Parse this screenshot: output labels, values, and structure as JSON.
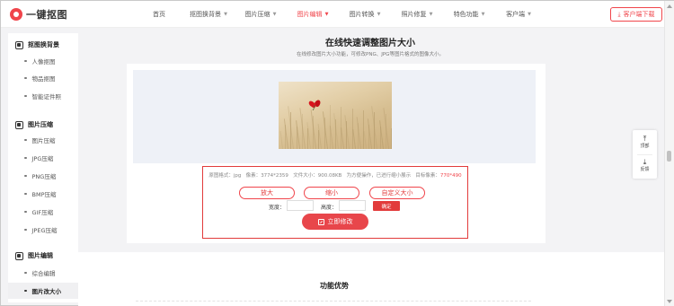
{
  "header": {
    "logo_text": "一键抠图",
    "nav": [
      {
        "label": "首页",
        "caret": false
      },
      {
        "label": "抠图换背景",
        "caret": true
      },
      {
        "label": "图片压缩",
        "caret": true
      },
      {
        "label": "图片编辑",
        "caret": true
      },
      {
        "label": "图片转换",
        "caret": true
      },
      {
        "label": "照片修复",
        "caret": true
      },
      {
        "label": "特色功能",
        "caret": true
      },
      {
        "label": "客户端",
        "caret": true
      }
    ],
    "active_nav": "图片编辑",
    "client_download": "客户端下载"
  },
  "sidebar": {
    "groups": [
      {
        "title": "抠图换背景",
        "icon": "cutout-icon",
        "items": [
          "人像抠图",
          "物品抠图",
          "智能证件照"
        ]
      },
      {
        "title": "图片压缩",
        "icon": "compress-icon",
        "items": [
          "图片压缩",
          "JPG压缩",
          "PNG压缩",
          "BMP压缩",
          "GIF压缩",
          "JPEG压缩"
        ]
      },
      {
        "title": "图片编辑",
        "icon": "edit-icon",
        "items": [
          "综合编辑",
          "图片改大小"
        ]
      }
    ],
    "active_item": "图片改大小"
  },
  "main": {
    "title": "在线快速调整图片大小",
    "subtitle": "在线修改图片大小功能，可修改PNG、JPG等图片格式的图像大小。",
    "info": {
      "format_label": "原图格式：",
      "format_value": "jpg",
      "pixels_label": "像素：",
      "pixels_value": "3774*2359",
      "filesize_label": "文件大小：",
      "filesize_value": "900.08KB",
      "note": "为方便操作，已进行缩小展示",
      "target_label": "目标像素：",
      "target_value": "770*490"
    },
    "buttons": {
      "enlarge": "放大",
      "shrink": "缩小",
      "custom": "自定义大小",
      "width_label": "宽度：",
      "height_label": "高度：",
      "width_value": "",
      "height_value": "",
      "confirm": "确定",
      "apply": "立即修改"
    },
    "features_title": "功能优势"
  },
  "floater": {
    "top_label": "顶部",
    "feedback_label": "反馈"
  },
  "colors": {
    "accent": "#f0454b",
    "border_highlight": "#e23b3b",
    "preview_bg": "#eef1f7"
  }
}
